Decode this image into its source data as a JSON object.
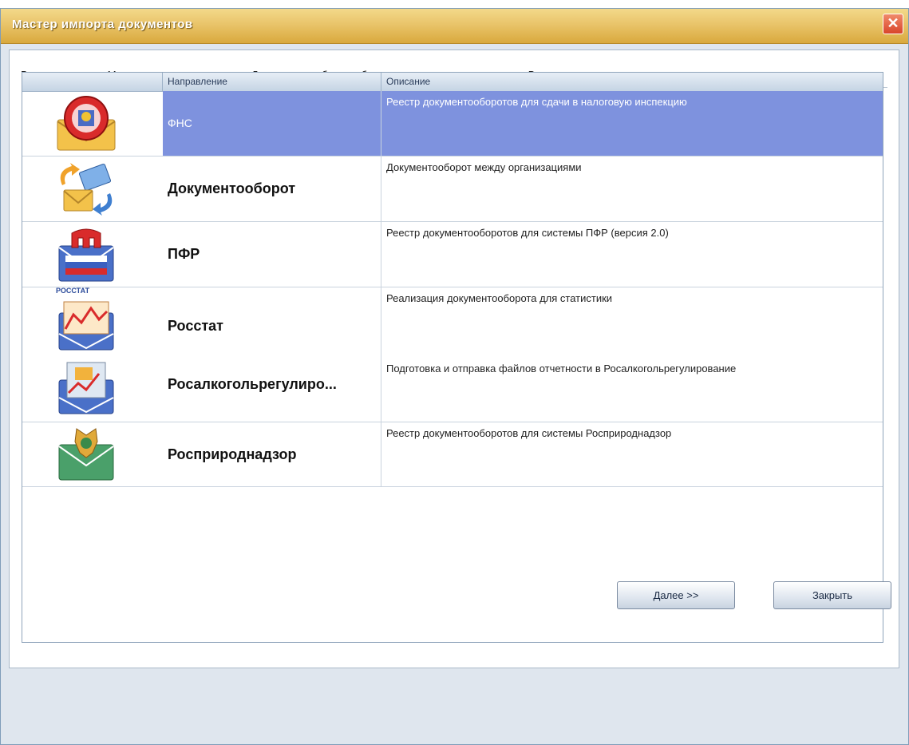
{
  "window": {
    "title": "Мастер импорта документов",
    "close_glyph": "✕"
  },
  "welcome_text": "Вас приветствует Мастер импорта документов. Для начала работы выберите направление, по которому Вы хотите проимпортировать документы",
  "grid": {
    "headers": [
      "",
      "Направление",
      "Описание"
    ],
    "rows": [
      {
        "icon": "fns-envelope-icon",
        "name": "ФНС",
        "desc": "Реестр документооборотов для сдачи в налоговую инспекцию",
        "selected": true
      },
      {
        "icon": "exchange-envelopes-icon",
        "name": "Документооборот",
        "desc": "Документооборот между организациями"
      },
      {
        "icon": "pfr-envelope-icon",
        "name": "ПФР",
        "desc": "Реестр документооборотов для системы ПФР (версия 2.0)"
      },
      {
        "icon": "rosstat-envelope-icon",
        "name": "Росстат",
        "desc": "Реализация документооборота для статистики",
        "badge": "РОССТАТ"
      },
      {
        "icon": "rosalko-envelope-icon",
        "name": "Росалкогольрегулиро...",
        "desc": "Подготовка и отправка файлов отчетности в Росалкогольрегулирование"
      },
      {
        "icon": "rosprirodnadzor-envelope-icon",
        "name": "Росприроднадзор",
        "desc": "Реестр документооборотов для системы Росприроднадзор"
      }
    ]
  },
  "buttons": {
    "next": "Далее >>",
    "close": "Закрыть"
  },
  "colors": {
    "selection": "#7e92de",
    "title_bar": "#e9c46a"
  }
}
